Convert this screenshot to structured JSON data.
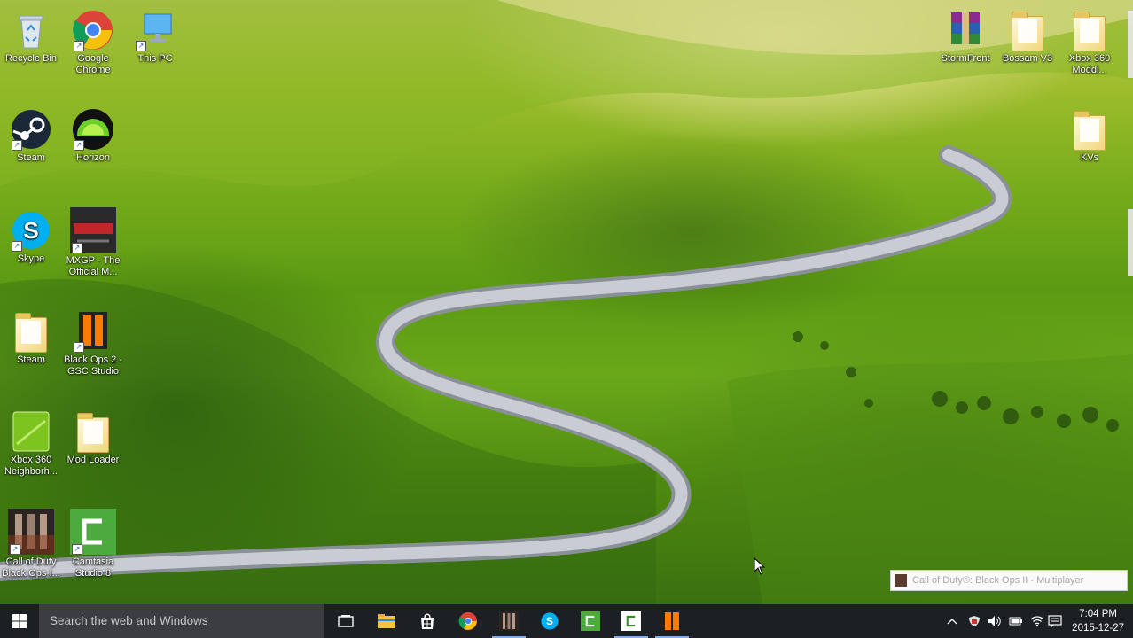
{
  "desktop": {
    "icons": [
      {
        "label": "Recycle Bin",
        "icon": "recycle-bin-icon"
      },
      {
        "label": "Google Chrome",
        "icon": "chrome-icon"
      },
      {
        "label": "This PC",
        "icon": "computer-icon"
      },
      {
        "label": "Steam",
        "icon": "steam-icon"
      },
      {
        "label": "Horizon",
        "icon": "horizon-icon"
      },
      {
        "label": "Skype",
        "icon": "skype-icon"
      },
      {
        "label": "MXGP - The Official M...",
        "icon": "mxgp-icon"
      },
      {
        "label": "Steam",
        "icon": "folder-icon"
      },
      {
        "label": "Black Ops 2 - GSC Studio",
        "icon": "black-ops-gsc-icon"
      },
      {
        "label": "Xbox 360 Neighborh...",
        "icon": "xbox-neighborhood-icon"
      },
      {
        "label": "Mod Loader",
        "icon": "folder-icon"
      },
      {
        "label": "Call of Duty Black Ops I...",
        "icon": "call-of-duty-icon"
      },
      {
        "label": "Camtasia Studio 8",
        "icon": "camtasia-icon"
      },
      {
        "label": "StormFront",
        "icon": "winrar-icon"
      },
      {
        "label": "Bossam V3",
        "icon": "folder-icon"
      },
      {
        "label": "Xbox 360 Moddi...",
        "icon": "folder-icon"
      },
      {
        "label": "KVs",
        "icon": "folder-icon"
      }
    ]
  },
  "preview": {
    "title": "Call of Duty®: Black Ops II - Multiplayer"
  },
  "taskbar": {
    "search_placeholder": "Search the web and Windows",
    "pinned": [
      "task-view",
      "file-explorer",
      "store",
      "chrome",
      "call-of-duty",
      "skype",
      "camtasia",
      "camtasia-recorder",
      "black-ops-gsc"
    ],
    "clock": {
      "time": "7:04 PM",
      "date": "2015-12-27"
    }
  },
  "colors": {
    "taskbar": "#1c1f24",
    "search": "#3b3d42",
    "accent": "#7fb0e8"
  }
}
